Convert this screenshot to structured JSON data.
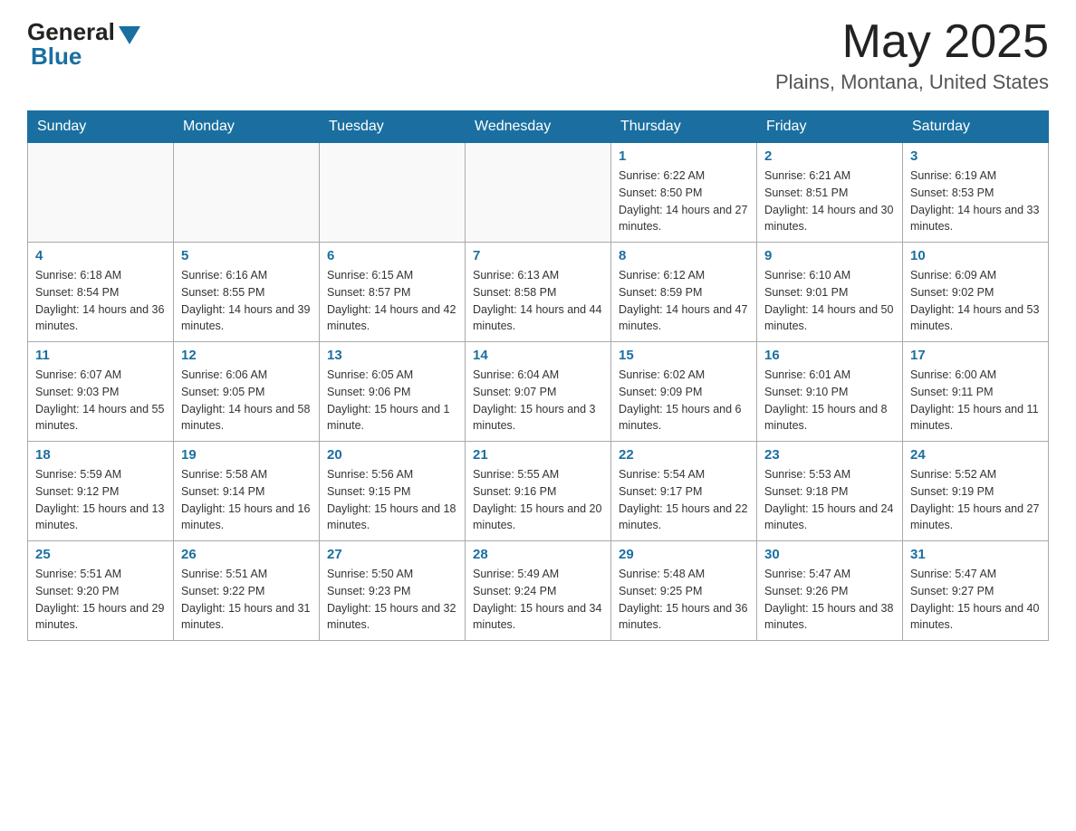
{
  "header": {
    "logo_general": "General",
    "logo_blue": "Blue",
    "month_title": "May 2025",
    "location": "Plains, Montana, United States"
  },
  "days_of_week": [
    "Sunday",
    "Monday",
    "Tuesday",
    "Wednesday",
    "Thursday",
    "Friday",
    "Saturday"
  ],
  "weeks": [
    [
      {
        "num": "",
        "info": ""
      },
      {
        "num": "",
        "info": ""
      },
      {
        "num": "",
        "info": ""
      },
      {
        "num": "",
        "info": ""
      },
      {
        "num": "1",
        "info": "Sunrise: 6:22 AM\nSunset: 8:50 PM\nDaylight: 14 hours and 27 minutes."
      },
      {
        "num": "2",
        "info": "Sunrise: 6:21 AM\nSunset: 8:51 PM\nDaylight: 14 hours and 30 minutes."
      },
      {
        "num": "3",
        "info": "Sunrise: 6:19 AM\nSunset: 8:53 PM\nDaylight: 14 hours and 33 minutes."
      }
    ],
    [
      {
        "num": "4",
        "info": "Sunrise: 6:18 AM\nSunset: 8:54 PM\nDaylight: 14 hours and 36 minutes."
      },
      {
        "num": "5",
        "info": "Sunrise: 6:16 AM\nSunset: 8:55 PM\nDaylight: 14 hours and 39 minutes."
      },
      {
        "num": "6",
        "info": "Sunrise: 6:15 AM\nSunset: 8:57 PM\nDaylight: 14 hours and 42 minutes."
      },
      {
        "num": "7",
        "info": "Sunrise: 6:13 AM\nSunset: 8:58 PM\nDaylight: 14 hours and 44 minutes."
      },
      {
        "num": "8",
        "info": "Sunrise: 6:12 AM\nSunset: 8:59 PM\nDaylight: 14 hours and 47 minutes."
      },
      {
        "num": "9",
        "info": "Sunrise: 6:10 AM\nSunset: 9:01 PM\nDaylight: 14 hours and 50 minutes."
      },
      {
        "num": "10",
        "info": "Sunrise: 6:09 AM\nSunset: 9:02 PM\nDaylight: 14 hours and 53 minutes."
      }
    ],
    [
      {
        "num": "11",
        "info": "Sunrise: 6:07 AM\nSunset: 9:03 PM\nDaylight: 14 hours and 55 minutes."
      },
      {
        "num": "12",
        "info": "Sunrise: 6:06 AM\nSunset: 9:05 PM\nDaylight: 14 hours and 58 minutes."
      },
      {
        "num": "13",
        "info": "Sunrise: 6:05 AM\nSunset: 9:06 PM\nDaylight: 15 hours and 1 minute."
      },
      {
        "num": "14",
        "info": "Sunrise: 6:04 AM\nSunset: 9:07 PM\nDaylight: 15 hours and 3 minutes."
      },
      {
        "num": "15",
        "info": "Sunrise: 6:02 AM\nSunset: 9:09 PM\nDaylight: 15 hours and 6 minutes."
      },
      {
        "num": "16",
        "info": "Sunrise: 6:01 AM\nSunset: 9:10 PM\nDaylight: 15 hours and 8 minutes."
      },
      {
        "num": "17",
        "info": "Sunrise: 6:00 AM\nSunset: 9:11 PM\nDaylight: 15 hours and 11 minutes."
      }
    ],
    [
      {
        "num": "18",
        "info": "Sunrise: 5:59 AM\nSunset: 9:12 PM\nDaylight: 15 hours and 13 minutes."
      },
      {
        "num": "19",
        "info": "Sunrise: 5:58 AM\nSunset: 9:14 PM\nDaylight: 15 hours and 16 minutes."
      },
      {
        "num": "20",
        "info": "Sunrise: 5:56 AM\nSunset: 9:15 PM\nDaylight: 15 hours and 18 minutes."
      },
      {
        "num": "21",
        "info": "Sunrise: 5:55 AM\nSunset: 9:16 PM\nDaylight: 15 hours and 20 minutes."
      },
      {
        "num": "22",
        "info": "Sunrise: 5:54 AM\nSunset: 9:17 PM\nDaylight: 15 hours and 22 minutes."
      },
      {
        "num": "23",
        "info": "Sunrise: 5:53 AM\nSunset: 9:18 PM\nDaylight: 15 hours and 24 minutes."
      },
      {
        "num": "24",
        "info": "Sunrise: 5:52 AM\nSunset: 9:19 PM\nDaylight: 15 hours and 27 minutes."
      }
    ],
    [
      {
        "num": "25",
        "info": "Sunrise: 5:51 AM\nSunset: 9:20 PM\nDaylight: 15 hours and 29 minutes."
      },
      {
        "num": "26",
        "info": "Sunrise: 5:51 AM\nSunset: 9:22 PM\nDaylight: 15 hours and 31 minutes."
      },
      {
        "num": "27",
        "info": "Sunrise: 5:50 AM\nSunset: 9:23 PM\nDaylight: 15 hours and 32 minutes."
      },
      {
        "num": "28",
        "info": "Sunrise: 5:49 AM\nSunset: 9:24 PM\nDaylight: 15 hours and 34 minutes."
      },
      {
        "num": "29",
        "info": "Sunrise: 5:48 AM\nSunset: 9:25 PM\nDaylight: 15 hours and 36 minutes."
      },
      {
        "num": "30",
        "info": "Sunrise: 5:47 AM\nSunset: 9:26 PM\nDaylight: 15 hours and 38 minutes."
      },
      {
        "num": "31",
        "info": "Sunrise: 5:47 AM\nSunset: 9:27 PM\nDaylight: 15 hours and 40 minutes."
      }
    ]
  ]
}
